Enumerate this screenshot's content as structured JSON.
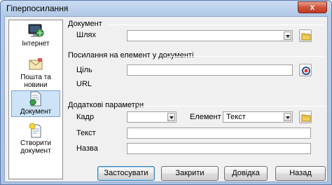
{
  "window": {
    "title": "Гіперпосилання",
    "close_label": "x"
  },
  "sidebar": {
    "items": [
      {
        "label": "Інтернет",
        "icon": "globe-monitor-icon",
        "selected": false
      },
      {
        "label": "Пошта та\nновини",
        "icon": "mail-icon",
        "selected": false
      },
      {
        "label": "Документ",
        "icon": "document-icon",
        "selected": true
      },
      {
        "label": "Створити\nдокумент",
        "icon": "new-document-icon",
        "selected": false
      }
    ]
  },
  "document_section": {
    "title": "Документ",
    "path_label": "Шлях",
    "path_value": ""
  },
  "target_section": {
    "title": "Посилання на елемент у документі",
    "target_label": "Ціль",
    "target_value": "",
    "url_label": "URL",
    "url_value": ""
  },
  "extra_section": {
    "title": "Додаткові параметри",
    "frame_label": "Кадр",
    "frame_value": "",
    "form_label": "Елемент",
    "form_value": "Текст",
    "text_label": "Текст",
    "text_value": "",
    "name_label": "Назва",
    "name_value": ""
  },
  "buttons": {
    "apply": "Застосувати",
    "close": "Закрити",
    "help": "Довідка",
    "back": "Назад"
  }
}
